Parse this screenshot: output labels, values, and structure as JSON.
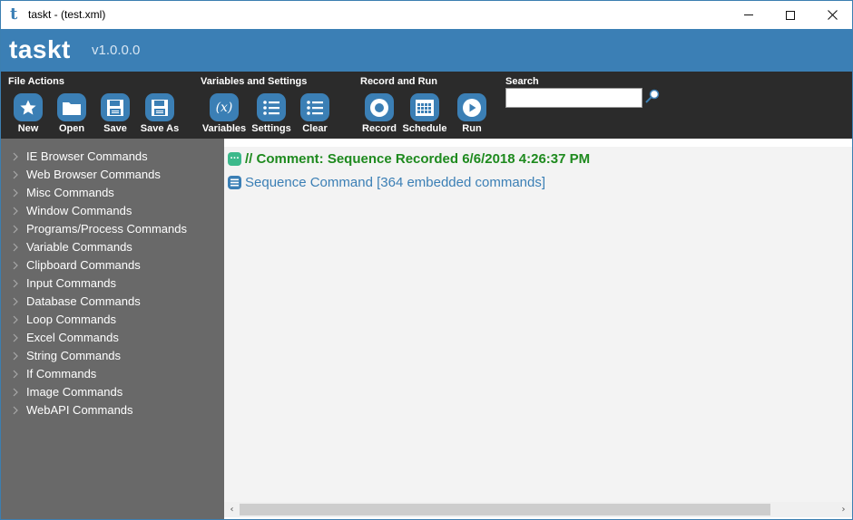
{
  "window": {
    "title": "taskt - (test.xml)",
    "app_glyph": "t",
    "controls": {
      "minimize_icon": "minimize-icon",
      "maximize_icon": "maximize-icon",
      "close_icon": "close-icon"
    }
  },
  "brand": {
    "name": "taskt",
    "version": "v1.0.0.0"
  },
  "toolbar": {
    "groups": [
      {
        "label": "File Actions"
      },
      {
        "label": "Variables and Settings"
      },
      {
        "label": "Record and Run"
      },
      {
        "label": "Search"
      }
    ],
    "buttons": [
      {
        "label": "New",
        "icon": "star-icon"
      },
      {
        "label": "Open",
        "icon": "folder-icon"
      },
      {
        "label": "Save",
        "icon": "save-icon"
      },
      {
        "label": "Save As",
        "icon": "save-as-icon"
      },
      {
        "label": "Variables",
        "icon": "variables-icon",
        "glyph": "(x)"
      },
      {
        "label": "Settings",
        "icon": "list-settings-icon"
      },
      {
        "label": "Clear",
        "icon": "list-clear-icon"
      },
      {
        "label": "Record",
        "icon": "record-icon"
      },
      {
        "label": "Schedule",
        "icon": "calendar-icon"
      },
      {
        "label": "Run",
        "icon": "play-icon"
      }
    ],
    "search": {
      "value": "",
      "placeholder": "",
      "icon": "search-icon"
    }
  },
  "sidebar": {
    "items": [
      {
        "label": "IE Browser Commands"
      },
      {
        "label": "Web Browser Commands"
      },
      {
        "label": "Misc Commands"
      },
      {
        "label": "Window Commands"
      },
      {
        "label": "Programs/Process Commands"
      },
      {
        "label": "Variable Commands"
      },
      {
        "label": "Clipboard Commands"
      },
      {
        "label": "Input Commands"
      },
      {
        "label": "Database Commands"
      },
      {
        "label": "Loop Commands"
      },
      {
        "label": "Excel Commands"
      },
      {
        "label": "String Commands"
      },
      {
        "label": "If Commands"
      },
      {
        "label": "Image Commands"
      },
      {
        "label": "WebAPI Commands"
      }
    ]
  },
  "commands": [
    {
      "text": "// Comment: Sequence Recorded 6/6/2018 4:26:37 PM",
      "icon": "comment-icon",
      "icon_glyph": "...",
      "color": "#1e8a1e"
    },
    {
      "text": "Sequence Command [364 embedded commands]",
      "icon": "sequence-icon",
      "color": "#3b7fb5"
    }
  ],
  "scrollbar": {
    "left_arrow": "‹",
    "right_arrow": "›"
  },
  "colors": {
    "brand": "#3b7fb5",
    "toolbar_bg": "#2b2b2b",
    "sidebar_bg": "#696969",
    "canvas_bg": "#f3f3f3",
    "comment": "#1e8a1e"
  }
}
